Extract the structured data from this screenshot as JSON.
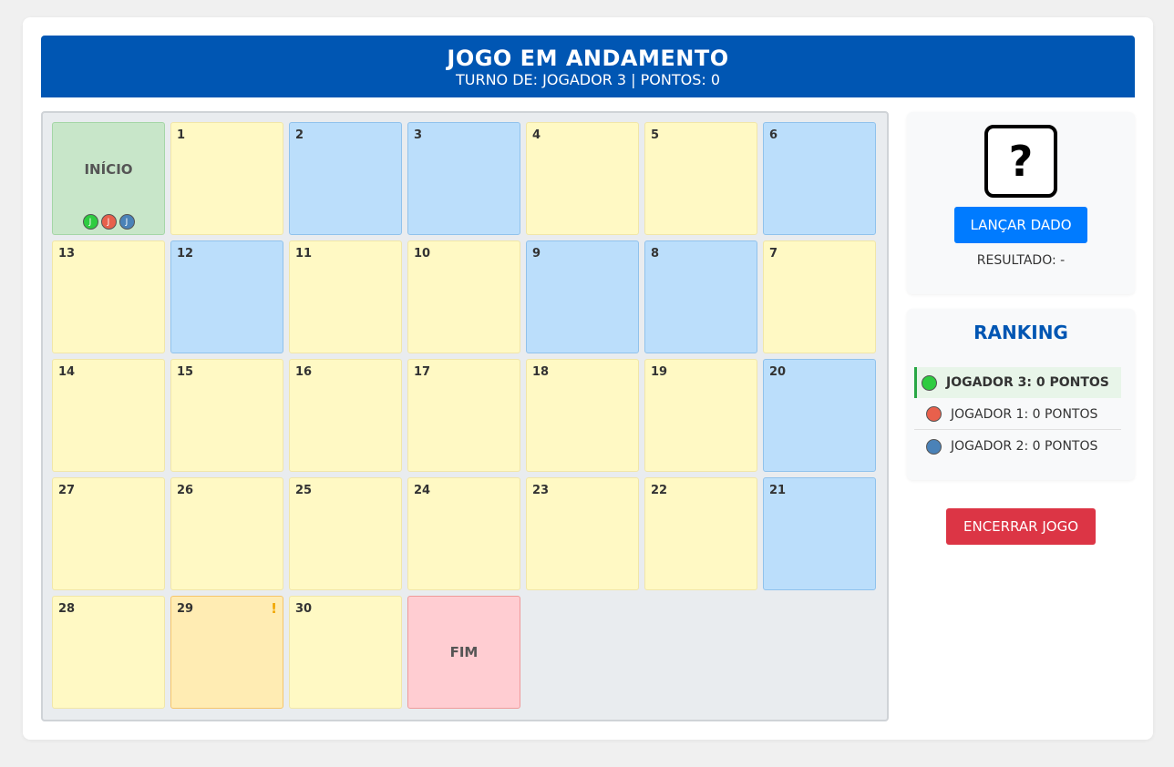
{
  "header": {
    "title": "JOGO EM ANDAMENTO",
    "subtitle": "TURNO DE: JOGADOR 3 | PONTOS: 0"
  },
  "board": {
    "start_label": "INÍCIO",
    "end_label": "FIM",
    "special_mark": "!",
    "token_initial": "J",
    "cells": [
      {
        "number": "1",
        "color": "yellow"
      },
      {
        "number": "2",
        "color": "blue"
      },
      {
        "number": "3",
        "color": "blue"
      },
      {
        "number": "4",
        "color": "yellow"
      },
      {
        "number": "5",
        "color": "yellow"
      },
      {
        "number": "6",
        "color": "blue"
      },
      {
        "number": "7",
        "color": "yellow"
      },
      {
        "number": "8",
        "color": "blue"
      },
      {
        "number": "9",
        "color": "blue"
      },
      {
        "number": "10",
        "color": "yellow"
      },
      {
        "number": "11",
        "color": "yellow"
      },
      {
        "number": "12",
        "color": "blue"
      },
      {
        "number": "13",
        "color": "yellow"
      },
      {
        "number": "14",
        "color": "yellow"
      },
      {
        "number": "15",
        "color": "yellow"
      },
      {
        "number": "16",
        "color": "yellow"
      },
      {
        "number": "17",
        "color": "yellow"
      },
      {
        "number": "18",
        "color": "yellow"
      },
      {
        "number": "19",
        "color": "yellow"
      },
      {
        "number": "20",
        "color": "blue"
      },
      {
        "number": "21",
        "color": "blue"
      },
      {
        "number": "22",
        "color": "yellow"
      },
      {
        "number": "23",
        "color": "yellow"
      },
      {
        "number": "24",
        "color": "yellow"
      },
      {
        "number": "25",
        "color": "yellow"
      },
      {
        "number": "26",
        "color": "yellow"
      },
      {
        "number": "27",
        "color": "yellow"
      },
      {
        "number": "28",
        "color": "yellow"
      },
      {
        "number": "29",
        "color": "special"
      },
      {
        "number": "30",
        "color": "yellow"
      }
    ],
    "tokens": [
      {
        "player": "JOGADOR 3",
        "color": "#2ecc40"
      },
      {
        "player": "JOGADOR 1",
        "color": "#e8604c"
      },
      {
        "player": "JOGADOR 2",
        "color": "#4a82b8"
      }
    ]
  },
  "dice": {
    "face": "?",
    "roll_label": "LANÇAR DADO",
    "result_text": "RESULTADO: -"
  },
  "ranking": {
    "title": "RANKING",
    "entries": [
      {
        "text": "JOGADOR 3: 0 PONTOS",
        "color": "#2ecc40",
        "active": true
      },
      {
        "text": "JOGADOR 1: 0 PONTOS",
        "color": "#e8604c",
        "active": false
      },
      {
        "text": "JOGADOR 2: 0 PONTOS",
        "color": "#4a82b8",
        "active": false
      }
    ]
  },
  "actions": {
    "end_game_label": "ENCERRAR JOGO"
  },
  "colors": {
    "header": "#0056b3",
    "primary_button": "#007bff",
    "danger_button": "#dc3545",
    "cell_yellow": "#fff9c4",
    "cell_blue": "#bbdefb",
    "cell_start": "#c8e6c9",
    "cell_end": "#ffcdd2",
    "cell_special": "#ffecb3"
  }
}
